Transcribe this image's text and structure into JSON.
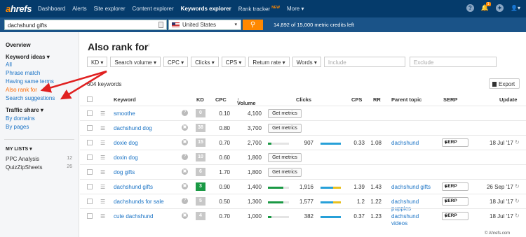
{
  "topnav": {
    "logo_a": "a",
    "logo_rest": "hrefs",
    "items": [
      "Dashboard",
      "Alerts",
      "Site explorer",
      "Content explorer",
      "Keywords explorer",
      "Rank tracker",
      "More"
    ],
    "new_badge": "NEW",
    "notif_count": "1"
  },
  "search": {
    "value": "dachshund gifts",
    "country": "United States",
    "credits": "14,892 of 15,000 metric credits left"
  },
  "sidebar": {
    "overview": "Overview",
    "keyword_ideas": "Keyword ideas",
    "all": "All",
    "phrase_match": "Phrase match",
    "having_same_terms": "Having same terms",
    "also_rank_for": "Also rank for",
    "search_suggestions": "Search suggestions",
    "traffic_share": "Traffic share",
    "by_domains": "By domains",
    "by_pages": "By pages",
    "my_lists": "MY LISTS",
    "lists": [
      {
        "name": "PPC Analysis",
        "count": "12"
      },
      {
        "name": "QuizZipSheets",
        "count": "26"
      }
    ]
  },
  "main": {
    "title": "Also rank for",
    "filters": [
      "KD",
      "Search volume",
      "CPC",
      "Clicks",
      "CPS",
      "Return rate",
      "Words"
    ],
    "include_placeholder": "Include",
    "exclude_placeholder": "Exclude",
    "count": "604 keywords",
    "export": "Export"
  },
  "table": {
    "headers": {
      "keyword": "Keyword",
      "kd": "KD",
      "cpc": "CPC",
      "volume": "Volume",
      "clicks": "Clicks",
      "cps": "CPS",
      "rr": "RR",
      "parent": "Parent topic",
      "serp": "SERP",
      "update": "Update"
    },
    "get_metrics": "Get metrics",
    "serp_btn": "SERP",
    "rows": [
      {
        "keyword": "smoothe",
        "kd": "0",
        "cpc": "0.10",
        "volume": "4,100"
      },
      {
        "keyword": "dachshund dog",
        "kd": "38",
        "cpc": "0.80",
        "volume": "3,700"
      },
      {
        "keyword": "doxie dog",
        "kd": "15",
        "cpc": "0.70",
        "volume": "2,700",
        "clicks": "907",
        "cps": "0.33",
        "rr": "1.08",
        "parent": "dachshund",
        "update": "18 Jul '17",
        "clicks_frac": 0.15,
        "cps_frac": 1.0
      },
      {
        "keyword": "doxin dog",
        "kd": "10",
        "cpc": "0.60",
        "volume": "1,800"
      },
      {
        "keyword": "dog gifts",
        "kd": "6",
        "cpc": "1.70",
        "volume": "1,800"
      },
      {
        "keyword": "dachshund gifts",
        "kd": "3",
        "cpc": "0.90",
        "volume": "1,400",
        "clicks": "1,916",
        "cps": "1.39",
        "rr": "1.43",
        "parent": "dachshund gifts",
        "update": "26 Sep '17",
        "clicks_frac": 0.72,
        "cps_frac": 0.62
      },
      {
        "keyword": "dachshunds for sale",
        "kd": "5",
        "cpc": "0.50",
        "volume": "1,300",
        "clicks": "1,577",
        "cps": "1.2",
        "rr": "1.22",
        "parent": "dachshund puppies",
        "update": "18 Jul '17",
        "clicks_frac": 0.72,
        "cps_frac": 0.62
      },
      {
        "keyword": "cute dachshund",
        "kd": "4",
        "cpc": "0.70",
        "volume": "1,000",
        "clicks": "382",
        "cps": "0.37",
        "rr": "1.23",
        "parent": "dachshund videos",
        "update": "18 Jul '17",
        "clicks_frac": 0.15,
        "cps_frac": 1.0
      }
    ]
  },
  "watermark": "© Ahrefs.com",
  "colors": {
    "nav": "#053b6b",
    "accent": "#ff8800",
    "link": "#1a73c5",
    "arrow": "#e02020",
    "kd_green": "#1a9944",
    "kd_grey": "#c8c8c8"
  }
}
